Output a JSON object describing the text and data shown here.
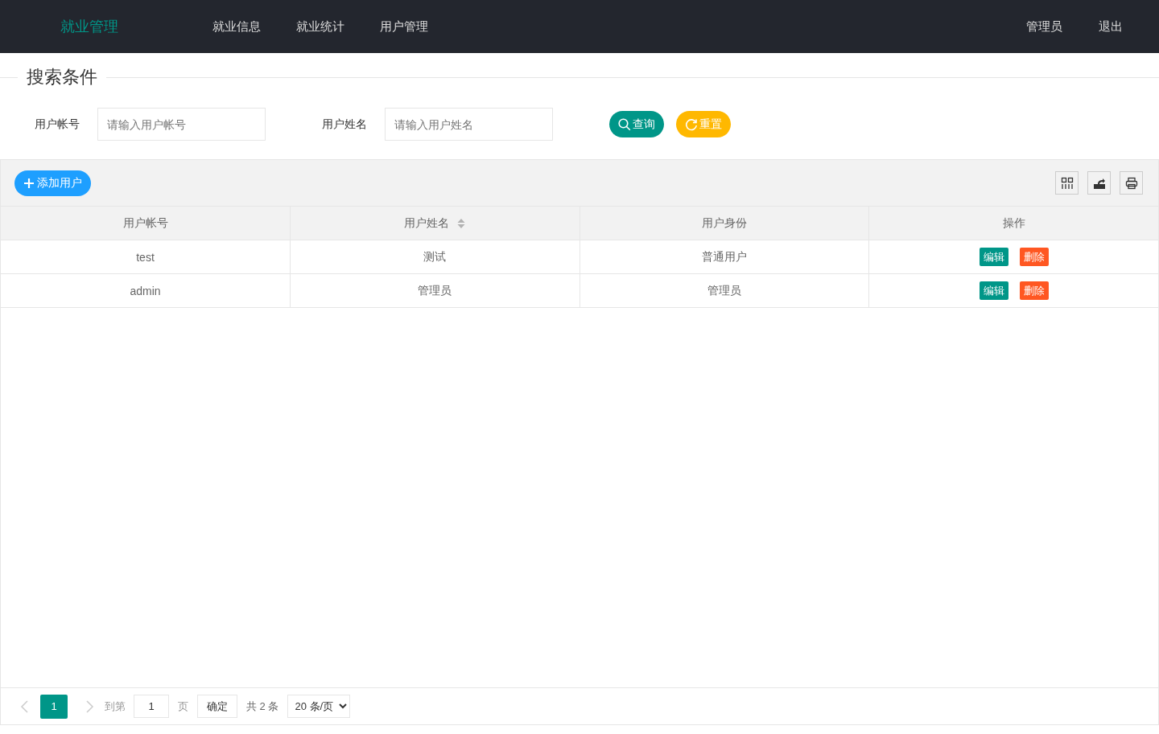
{
  "header": {
    "logo": "就业管理",
    "nav": [
      "就业信息",
      "就业统计",
      "用户管理"
    ],
    "user": "管理员",
    "logout": "退出"
  },
  "search": {
    "title": "搜索条件",
    "fields": [
      {
        "label": "用户帐号",
        "placeholder": "请输入用户帐号"
      },
      {
        "label": "用户姓名",
        "placeholder": "请输入用户姓名"
      }
    ],
    "buttons": [
      {
        "label": "查询",
        "kind": "search"
      },
      {
        "label": "重置",
        "kind": "reset"
      }
    ]
  },
  "toolbar": {
    "add_button": "添加用户",
    "tools": [
      {
        "kind": "columns"
      },
      {
        "kind": "export"
      },
      {
        "kind": "print"
      }
    ]
  },
  "table": {
    "columns": [
      {
        "label": "用户帐号",
        "sortable": false
      },
      {
        "label": "用户姓名",
        "sortable": true
      },
      {
        "label": "用户身份",
        "sortable": false
      },
      {
        "label": "操作",
        "sortable": false
      }
    ],
    "rows": [
      {
        "cells": [
          "test",
          "测试",
          "普通用户"
        ],
        "actions": [
          {
            "label": "编辑",
            "kind": "edit"
          },
          {
            "label": "删除",
            "kind": "delete"
          }
        ]
      },
      {
        "cells": [
          "admin",
          "管理员",
          "管理员"
        ],
        "actions": [
          {
            "label": "编辑",
            "kind": "edit"
          },
          {
            "label": "删除",
            "kind": "delete"
          }
        ]
      }
    ]
  },
  "pagination": {
    "pages": [
      {
        "label": "1",
        "selected": true
      }
    ],
    "goto_label": "到第",
    "goto_value": "1",
    "page_unit": "页",
    "confirm": "确定",
    "total": "共 2 条",
    "page_size": "20 条/页"
  }
}
